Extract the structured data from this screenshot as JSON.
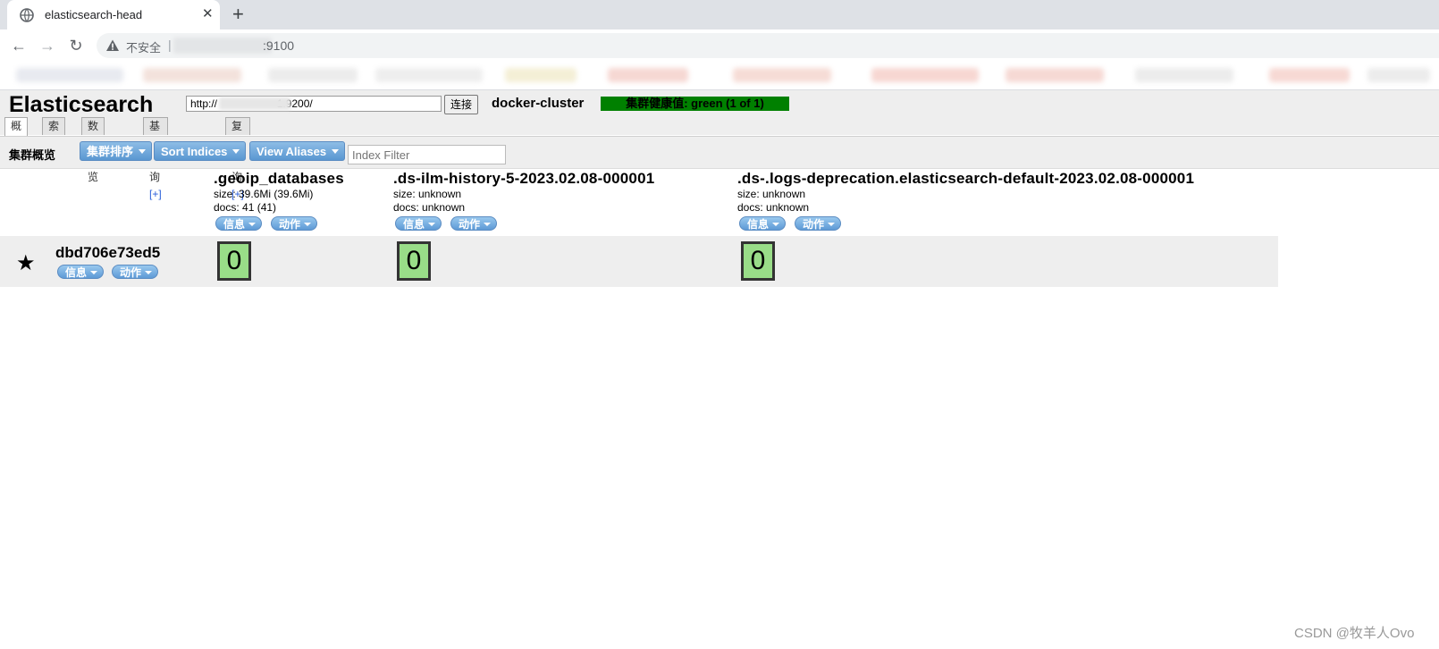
{
  "browser": {
    "tab_title": "elasticsearch-head",
    "tab_close": "✕",
    "new_tab": "+",
    "insecure_label": "不安全",
    "url_separator": "|",
    "url_port": ":9100"
  },
  "app": {
    "logo": "Elasticsearch",
    "connect_url": "http://                    1:9200/",
    "connect_label": "连接",
    "cluster_name": "docker-cluster",
    "health": "集群健康值: green (1 of 1)",
    "health_color": "#008000",
    "tabs": [
      {
        "label": "概览",
        "plus": ""
      },
      {
        "label": "索引",
        "plus": ""
      },
      {
        "label": "数据浏览",
        "plus": ""
      },
      {
        "label": "基本查询",
        "plus": "[+]"
      },
      {
        "label": "复合查询",
        "plus": "[+]"
      }
    ],
    "subbar": {
      "title": "集群概览",
      "sort_cluster_label": "集群排序",
      "sort_indices_label": "Sort Indices",
      "view_aliases_label": "View Aliases",
      "filter_placeholder": "Index Filter"
    }
  },
  "info_label": "信息",
  "action_label": "动作",
  "indices": [
    {
      "name": ".geoip_databases",
      "size": "size: 39.6Mi (39.6Mi)",
      "docs": "docs: 41 (41)",
      "shard": "0"
    },
    {
      "name": ".ds-ilm-history-5-2023.02.08-000001",
      "size": "size: unknown",
      "docs": "docs: unknown",
      "shard": "0"
    },
    {
      "name": ".ds-.logs-deprecation.elasticsearch-default-2023.02.08-000001",
      "size": "size: unknown",
      "docs": "docs: unknown",
      "shard": "0"
    }
  ],
  "node": {
    "name": "dbd706e73ed5",
    "star": "★"
  },
  "colors": {
    "shard_fill": "#99dd88",
    "button_blue": "#5a97d1"
  },
  "watermark": "CSDN @牧羊人Ovo"
}
